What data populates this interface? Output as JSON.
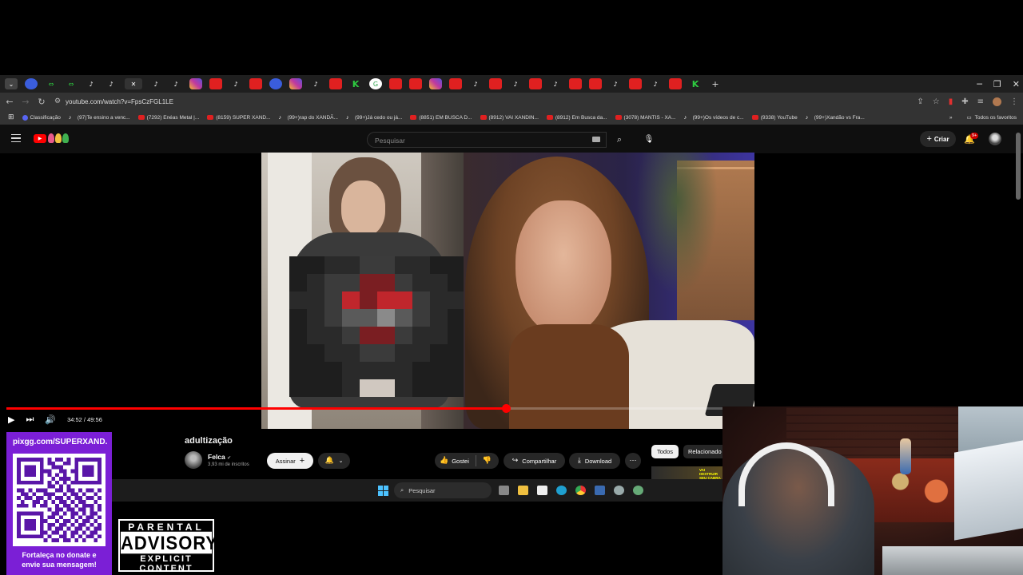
{
  "browser": {
    "url": "youtube.com/watch?v=FpsCzFGL1LE",
    "tabs": [
      "tk",
      "tk",
      "ig",
      "yt",
      "tk",
      "yt",
      "blue",
      "ig",
      "tk",
      "yt",
      "green",
      "g",
      "yt",
      "yt",
      "ig",
      "yt",
      "tk",
      "yt",
      "tk",
      "yt",
      "tk",
      "yt",
      "yt",
      "tk",
      "yt",
      "tk",
      "yt",
      "green"
    ],
    "bookmarks": [
      {
        "icon": "disc",
        "label": "Classificação"
      },
      {
        "icon": "tk",
        "label": "(97)Te ensino a venc..."
      },
      {
        "icon": "yt",
        "label": "(7292) Enéas Metal |..."
      },
      {
        "icon": "yt",
        "label": "(8159) SUPER XAND..."
      },
      {
        "icon": "tk",
        "label": "(99+)rap do XANDÃ..."
      },
      {
        "icon": "tk",
        "label": "(99+)Já cedo ou já..."
      },
      {
        "icon": "yt",
        "label": "(8851) EM BUSCA D..."
      },
      {
        "icon": "yt",
        "label": "(8912) VAI XANDIN..."
      },
      {
        "icon": "yt",
        "label": "(8912) Em Busca da..."
      },
      {
        "icon": "yt",
        "label": "(3078) MANTIS - XA..."
      },
      {
        "icon": "tk",
        "label": "(99+)Os vídeos de c..."
      },
      {
        "icon": "yt",
        "label": "(9338) YouTube"
      },
      {
        "icon": "tk",
        "label": "(99+)Xandão vs Fra..."
      }
    ],
    "all_bookmarks": "Todos os favoritos"
  },
  "youtube": {
    "search_placeholder": "Pesquisar",
    "create_label": "Criar",
    "notif_count": "9+",
    "player": {
      "time": "34:52 / 49:56",
      "progress": 0.698
    },
    "video": {
      "title": "adultização",
      "channel": "Felca",
      "verified_icon": "✔",
      "subscribers": "3,93 mi de inscritos",
      "subscribe_label": "Assinar",
      "like_label": "Gostei",
      "share_label": "Compartilhar",
      "download_label": "Download"
    },
    "chips": {
      "all": "Todos",
      "related": "Relacionado"
    },
    "thumb_text": "VAI DESTRUIR SEU CABRA"
  },
  "taskbar": {
    "search_placeholder": "Pesquisar"
  },
  "overlay": {
    "qr_url": "pixgg.com/SUPERXAND.",
    "qr_caption_1": "Fortaleça no donate e",
    "qr_caption_2": "envie sua mensagem!",
    "qr_pattern": [
      "1111111010110101111111",
      "1000001011001101000001",
      "1011101001110001011101",
      "1011101110011011011101",
      "1011101010101001011101",
      "1000001001011101000001",
      "1111111010101011111111",
      "0000000011010100000000",
      "1101011100110110101101",
      "0110100111001011010010",
      "1011011010110101101101",
      "0100110101011010110010",
      "1110101100101101011101",
      "0000000010110110110101",
      "1111111001101011010110",
      "1000001011010010101101",
      "1011101100101101011010",
      "1011101011011010110101",
      "1011101010110101101011",
      "1000001101101011010110",
      "1111111010011010101101",
      "0000000101101101010010"
    ],
    "advisory_top": "PARENTAL",
    "advisory_mid": "ADVISORY",
    "advisory_bottom": "EXPLICIT CONTENT"
  },
  "colors": {
    "accent": "#ff0000",
    "qr_panel": "#7b1fd6"
  }
}
